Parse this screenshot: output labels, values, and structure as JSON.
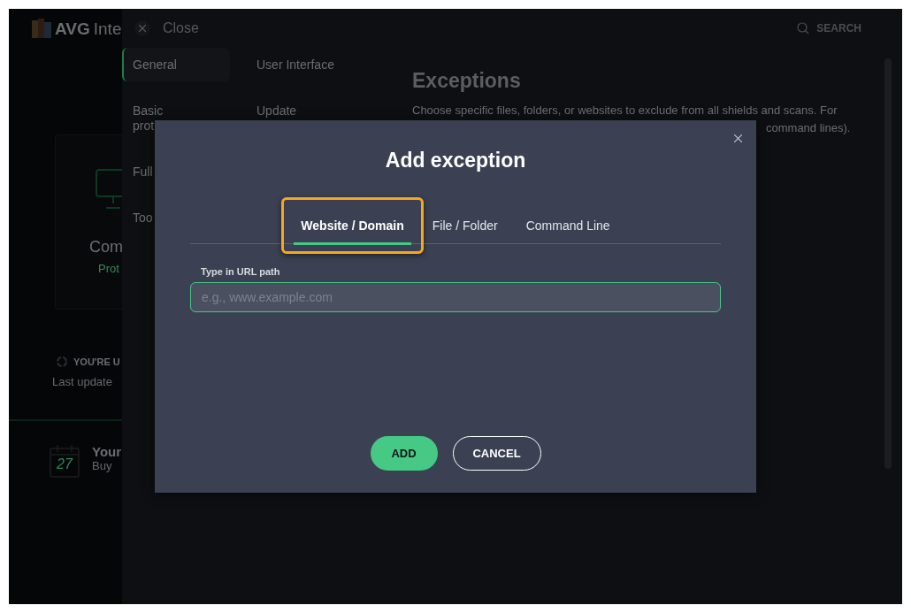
{
  "app": {
    "logo_text": "AVG",
    "title": "Inte",
    "card": {
      "title": "Com",
      "status": "Prot"
    },
    "update": {
      "status": "YOU'RE U",
      "detail": "Last update"
    },
    "promo": {
      "day": "27",
      "title": "Your",
      "detail": "Buy"
    }
  },
  "settings": {
    "close_label": "Close",
    "search_label": "SEARCH",
    "nav_columns": [
      [
        {
          "label": "General",
          "selected": true
        },
        {
          "label": "Basic prot",
          "selected": false
        },
        {
          "label": "Full",
          "selected": false
        },
        {
          "label": "Too",
          "selected": false
        }
      ],
      [
        {
          "label": "User Interface",
          "selected": false
        },
        {
          "label": "Update",
          "selected": false
        }
      ]
    ],
    "heading": "Exceptions",
    "description": [
      "Choose specific files, folders, or websites to exclude from all shields and scans. For",
      "command lines)."
    ]
  },
  "dialog": {
    "title": "Add exception",
    "tabs": [
      {
        "label": "Website / Domain",
        "selected": true,
        "highlighted": true
      },
      {
        "label": "File / Folder",
        "selected": false,
        "highlighted": false
      },
      {
        "label": "Command Line",
        "selected": false,
        "highlighted": false
      }
    ],
    "field": {
      "label": "Type in URL path",
      "placeholder": "e.g., www.example.com"
    },
    "buttons": [
      {
        "label": "ADD",
        "kind": "primary"
      },
      {
        "label": "CANCEL",
        "kind": "secondary"
      }
    ]
  }
}
